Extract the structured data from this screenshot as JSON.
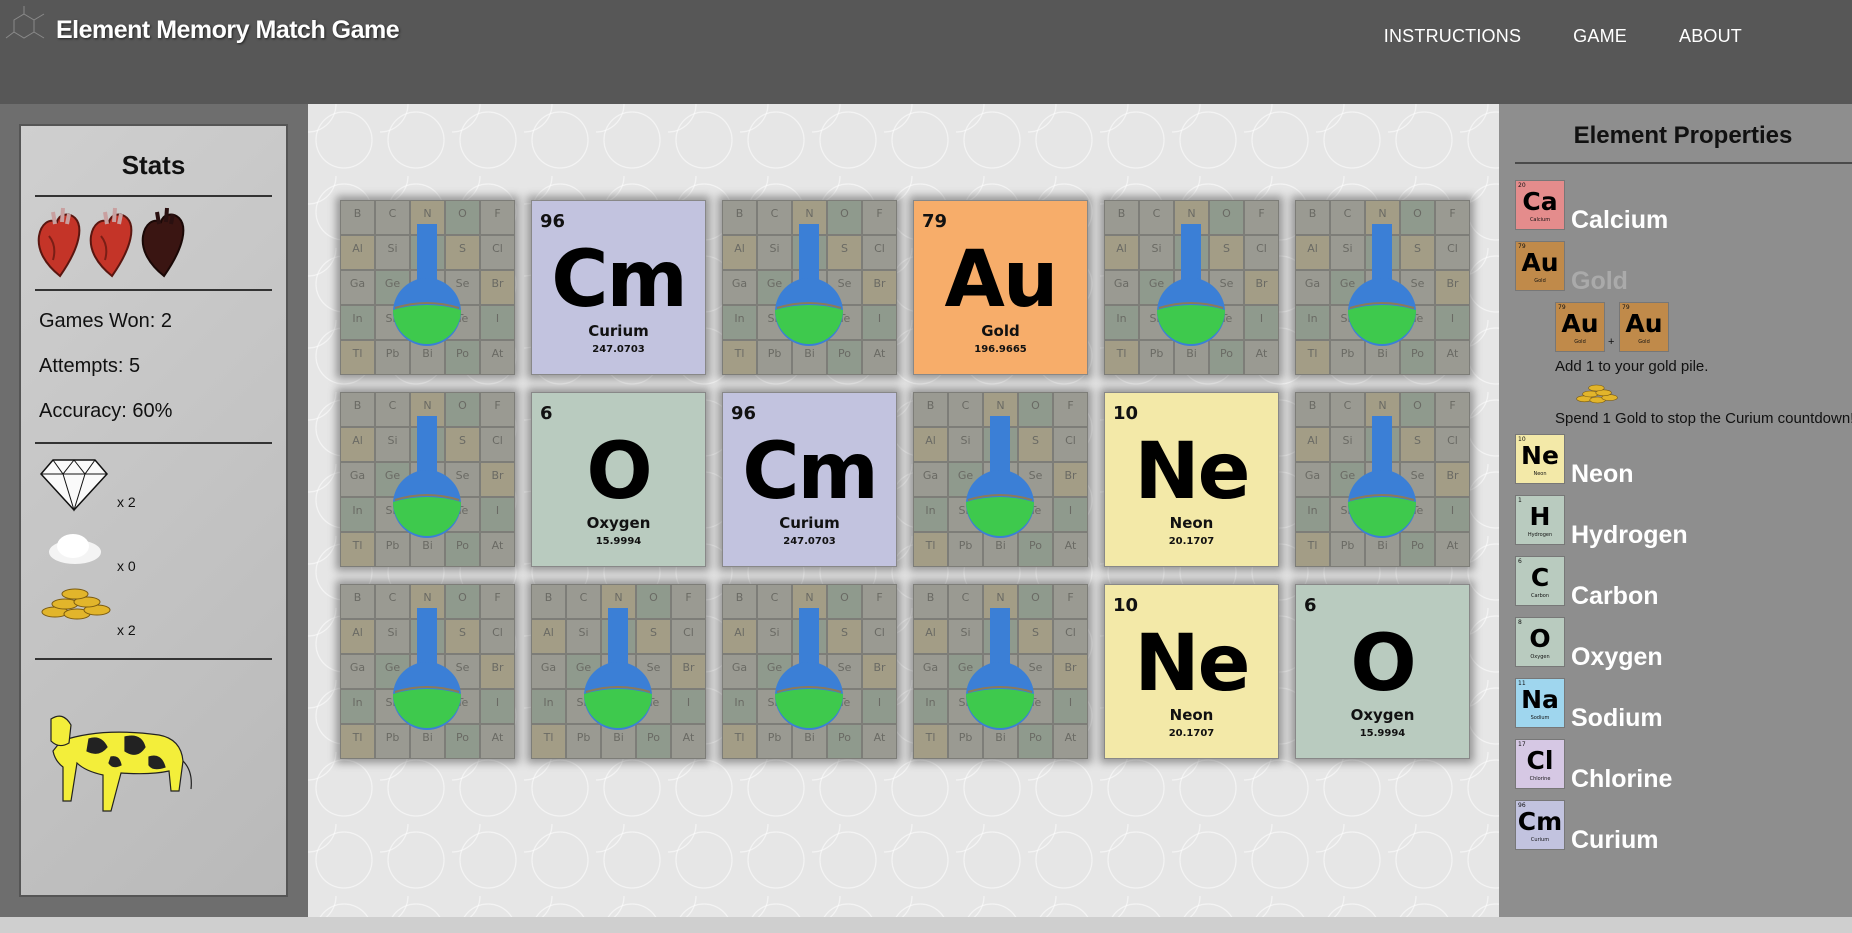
{
  "header": {
    "title": "Element Memory Match Game",
    "nav": [
      "INSTRUCTIONS",
      "GAME",
      "ABOUT"
    ]
  },
  "stats": {
    "title": "Stats",
    "hearts": {
      "total": 3,
      "full": 2
    },
    "games_won": "Games Won: 2",
    "attempts": "Attempts: 5",
    "accuracy": "Accuracy: 60%",
    "items": [
      {
        "icon": "diamond-icon",
        "count": "x 2"
      },
      {
        "icon": "salt-pile-icon",
        "count": "x 0"
      },
      {
        "icon": "gold-coins-icon",
        "count": "x 2"
      }
    ]
  },
  "back_symbols": [
    "B",
    "C",
    "N",
    "O",
    "F",
    "Al",
    "Si",
    "P",
    "S",
    "Cl",
    "Ga",
    "Ge",
    "As",
    "Se",
    "Br",
    "In",
    "Sn",
    "Sb",
    "Te",
    "I",
    "Tl",
    "Pb",
    "Bi",
    "Po",
    "At"
  ],
  "board": {
    "cards": [
      {
        "state": "back"
      },
      {
        "state": "face",
        "number": "96",
        "symbol": "Cm",
        "name": "Curium",
        "mass": "247.0703",
        "color": "#c2c3df"
      },
      {
        "state": "back"
      },
      {
        "state": "face",
        "number": "79",
        "symbol": "Au",
        "name": "Gold",
        "mass": "196.9665",
        "color": "#f7ad6a"
      },
      {
        "state": "back"
      },
      {
        "state": "back"
      },
      {
        "state": "back"
      },
      {
        "state": "face",
        "number": "6",
        "symbol": "O",
        "name": "Oxygen",
        "mass": "15.9994",
        "color": "#b9cbbf"
      },
      {
        "state": "face",
        "number": "96",
        "symbol": "Cm",
        "name": "Curium",
        "mass": "247.0703",
        "color": "#c2c3df"
      },
      {
        "state": "back"
      },
      {
        "state": "face",
        "number": "10",
        "symbol": "Ne",
        "name": "Neon",
        "mass": "20.1707",
        "color": "#f3e9a8"
      },
      {
        "state": "back"
      },
      {
        "state": "back"
      },
      {
        "state": "back"
      },
      {
        "state": "back"
      },
      {
        "state": "back"
      },
      {
        "state": "face",
        "number": "10",
        "symbol": "Ne",
        "name": "Neon",
        "mass": "20.1707",
        "color": "#f3e9a8"
      },
      {
        "state": "face",
        "number": "6",
        "symbol": "O",
        "name": "Oxygen",
        "mass": "15.9994",
        "color": "#b9cbbf"
      }
    ]
  },
  "properties": {
    "title": "Element Properties",
    "elements": [
      {
        "number": "20",
        "symbol": "Ca",
        "name": "Calcium",
        "color": "#e48c8c",
        "dim": false
      },
      {
        "number": "79",
        "symbol": "Au",
        "name": "Gold",
        "color": "#c08a4a",
        "dim": true
      },
      {
        "number": "10",
        "symbol": "Ne",
        "name": "Neon",
        "color": "#f3e9a8",
        "dim": false
      },
      {
        "number": "1",
        "symbol": "H",
        "name": "Hydrogen",
        "color": "#b9cbbf",
        "dim": false
      },
      {
        "number": "6",
        "symbol": "C",
        "name": "Carbon",
        "color": "#b9cbbf",
        "dim": false
      },
      {
        "number": "8",
        "symbol": "O",
        "name": "Oxygen",
        "color": "#b9cbbf",
        "dim": false
      },
      {
        "number": "11",
        "symbol": "Na",
        "name": "Sodium",
        "color": "#9fd6ee",
        "dim": false
      },
      {
        "number": "17",
        "symbol": "Cl",
        "name": "Chlorine",
        "color": "#d6c8e4",
        "dim": false
      },
      {
        "number": "96",
        "symbol": "Cm",
        "name": "Curium",
        "color": "#c2c3df",
        "dim": false
      }
    ],
    "gold_combo": {
      "plus": "+",
      "symbol": "Au",
      "number": "79",
      "name": "Gold"
    },
    "gold_ability": "Add 1 to your gold pile.",
    "gold_spend": "Spend 1 Gold to stop the Curium countdown!"
  }
}
